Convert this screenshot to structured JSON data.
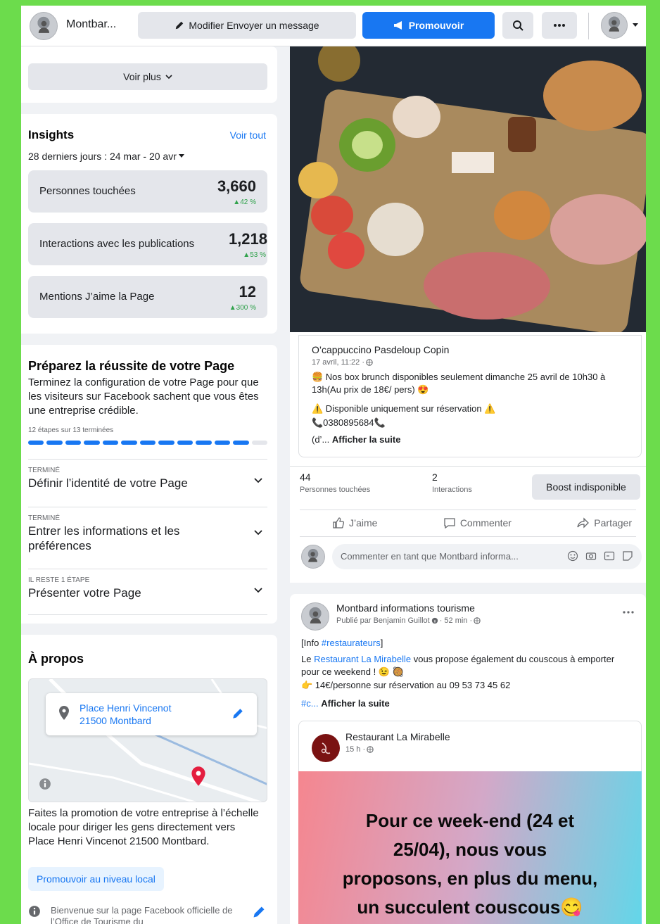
{
  "topbar": {
    "page_name": "Montbar...",
    "edit_send_label": "Modifier Envoyer un message",
    "promote_label": "Promouvoir"
  },
  "left": {
    "see_more": "Voir plus",
    "insights": {
      "title": "Insights",
      "see_all": "Voir tout",
      "period": "28 derniers jours : 24 mar - 20 avr",
      "stats": [
        {
          "label": "Personnes touchées",
          "value": "3,660",
          "delta": "▲42 %"
        },
        {
          "label": "Interactions avec les publications",
          "value": "1,218",
          "delta": "▲53 %"
        },
        {
          "label": "Mentions J’aime la Page",
          "value": "12",
          "delta": "▲300 %"
        }
      ]
    },
    "setup": {
      "title": "Préparez la réussite de votre Page",
      "description": "Terminez la configuration de votre Page pour que les visiteurs sur Facebook sachent que vous êtes une entreprise crédible.",
      "progress_text": "12 étapes sur 13 terminées",
      "steps_done": 12,
      "steps_total": 13,
      "steps": [
        {
          "status": "TERMINÉ",
          "label": "Définir l’identité de votre Page"
        },
        {
          "status": "TERMINÉ",
          "label": "Entrer les informations et les préférences"
        },
        {
          "status": "IL RESTE 1 ÉTAPE",
          "label": "Présenter votre Page"
        }
      ]
    },
    "about": {
      "title": "À propos",
      "address_line1": "Place Henri Vincenot",
      "address_line2": "21500 Montbard",
      "promo_text": "Faites la promotion de votre entreprise à l’échelle locale pour diriger les gens directement vers Place Henri Vincenot 21500 Montbard.",
      "promo_button": "Promouvoir au niveau local",
      "welcome_text": "Bienvenue sur la page Facebook officielle de l’Office de Tourisme du"
    }
  },
  "right": {
    "post1": {
      "author": "O’cappuccino Pasdeloup Copin",
      "date": "17 avril, 11:22 · ",
      "line1": "🍔 Nos box brunch disponibles seulement dimanche 25 avril de 10h30 à 13h(Au prix de 18€/ pers) 😍",
      "line2": "⚠️ Disponible uniquement sur réservation ⚠️",
      "line3": "📞0380895684📞",
      "line4_prefix": "(d’... ",
      "see_more": "Afficher la suite",
      "reach_value": "44",
      "reach_label": "Personnes touchées",
      "interactions_value": "2",
      "interactions_label": "Interactions",
      "boost_label": "Boost indisponible",
      "like": "J’aime",
      "comment": "Commenter",
      "share": "Partager",
      "comment_placeholder": "Commenter en tant que Montbard informa..."
    },
    "post2": {
      "author": "Montbard informations tourisme",
      "published_by": "Publié par Benjamin Guillot",
      "time": " · 52 min · ",
      "tag_line_prefix": "[Info ",
      "tag_line_hashtag": "#restaurateurs",
      "tag_line_suffix": "]",
      "text_prefix": "Le ",
      "text_link": "Restaurant La Mirabelle",
      "text_suffix": " vous propose également du couscous à emporter pour ce weekend ! 😉 🥘",
      "price_line": "👉 14€/personne sur réservation au 09 53 73 45 62",
      "hashtag_prefix": "#c... ",
      "see_more": "Afficher la suite",
      "shared_author": "Restaurant La Mirabelle",
      "shared_time": "15 h · ",
      "banner_line1": "Pour ce week-end (24 et",
      "banner_line2": "25/04), nous vous",
      "banner_line3": "proposons, en plus du menu,",
      "banner_line4": "un succulent couscous😋"
    }
  },
  "colors": {
    "accent": "#1877f2",
    "positive": "#31a24c",
    "frame_bg": "#6cdc4c"
  }
}
